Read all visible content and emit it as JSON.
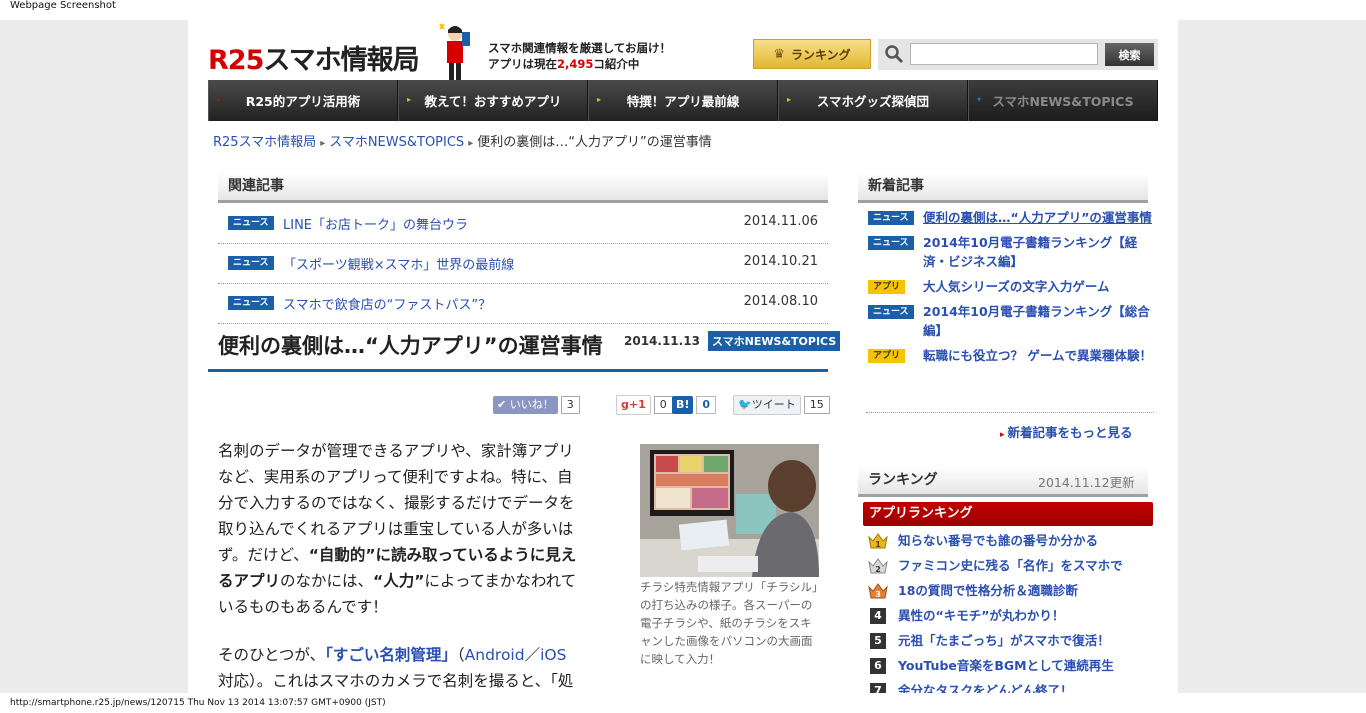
{
  "capture_label": "Webpage Screenshot",
  "status_bar": "http://smartphone.r25.jp/news/120715 Thu Nov 13 2014 13:07:57 GMT+0900 (JST)",
  "header": {
    "logo_r25": "R25",
    "logo_rest": "スマホ情報局",
    "tagline_line1": "スマホ関連情報を厳選してお届け！",
    "tagline_prefix": "アプリは現在",
    "tagline_count": "2,495",
    "tagline_suffix": "コ紹介中",
    "ranking_button": "ランキング",
    "search_placeholder": "",
    "search_button": "検索"
  },
  "nav": [
    {
      "label": "R25的アプリ活用術"
    },
    {
      "label": "教えて！おすすめアプリ"
    },
    {
      "label": "特撰！アプリ最前線"
    },
    {
      "label": "スマホグッズ探偵団"
    },
    {
      "label": "スマホNEWS&TOPICS"
    }
  ],
  "breadcrumb": {
    "home": "R25スマホ情報局",
    "section": "スマホNEWS&TOPICS",
    "current": "便利の裏側は…“人力アプリ”の運営事情"
  },
  "related": {
    "title": "関連記事",
    "items": [
      {
        "badge": "ニュース",
        "title": "LINE「お店トーク」の舞台ウラ",
        "date": "2014.11.06"
      },
      {
        "badge": "ニュース",
        "title": "「スポーツ観戦×スマホ」世界の最前線",
        "date": "2014.10.21"
      },
      {
        "badge": "ニュース",
        "title": "スマホで飲食店の“ファストパス”？",
        "date": "2014.08.10"
      }
    ]
  },
  "article": {
    "title": "便利の裏側は…“人力アプリ”の運営事情",
    "date": "2014.11.13",
    "category": "スマホNEWS&TOPICS",
    "social": {
      "like_label": "いいね！",
      "like_count": "3",
      "gplus_label": "g+1",
      "gplus_count": "0",
      "hatena_label": "B!",
      "hatena_count": "0",
      "tweet_label": "ツイート",
      "tweet_count": "15"
    },
    "p1_a": "名刺のデータが管理できるアプリや、家計簿アプリなど、実用系のアプリって便利ですよね。特に、自分で入力するのではなく、撮影するだけでデータを取り込んでくれるアプリは重宝している人が多いはず。だけど、",
    "p1_b": "“自動的”に読み取っているように見えるアプリ",
    "p1_c": "のなかには、",
    "p1_d": "“人力”",
    "p1_e": "によってまかなわれているものもあるんです！",
    "p2_a": "そのひとつが、",
    "p2_b": "「すごい名刺管理」",
    "p2_c": "（",
    "p2_d": "Android",
    "p2_e": "／",
    "p2_f": "iOS",
    "p2_g": "対応）。これはスマホのカメラで名刺を撮ると、「処理",
    "photo_caption": "チラシ特売情報アプリ「チラシル」の打ち込みの様子。各スーパーの電子チラシや、紙のチラシをスキャンした画像をパソコンの大画面に映して入力！"
  },
  "sidebar": {
    "new_title": "新着記事",
    "new_items": [
      {
        "badge": "ニュース",
        "type": "news",
        "title": "便利の裏側は…“人力アプリ”の運営事情"
      },
      {
        "badge": "ニュース",
        "type": "news",
        "title": "2014年10月電子書籍ランキング【経済・ビジネス編】"
      },
      {
        "badge": "アプリ",
        "type": "app",
        "title": "大人気シリーズの文字入力ゲーム"
      },
      {
        "badge": "ニュース",
        "type": "news",
        "title": "2014年10月電子書籍ランキング【総合編】"
      },
      {
        "badge": "アプリ",
        "type": "app",
        "title": "転職にも役立つ？ ゲームで異業種体験！"
      }
    ],
    "more_link": "新着記事をもっと見る",
    "ranking_title": "ランキング",
    "ranking_updated": "2014.11.12更新",
    "ranking_sub": "アプリランキング",
    "ranking": [
      {
        "rank": "1",
        "title": "知らない番号でも誰の番号か分かる"
      },
      {
        "rank": "2",
        "title": "ファミコン史に残る「名作」をスマホで"
      },
      {
        "rank": "3",
        "title": "18の質問で性格分析＆適職診断"
      },
      {
        "rank": "4",
        "title": "異性の“キモチ”が丸わかり！"
      },
      {
        "rank": "5",
        "title": "元祖「たまごっち」がスマホで復活！"
      },
      {
        "rank": "6",
        "title": "YouTube音楽をBGMとして連続再生"
      },
      {
        "rank": "7",
        "title": "余分なタスクをどんどん終了！"
      }
    ]
  },
  "colors": {
    "brand_red": "#d40000",
    "link_blue": "#2a4fb0",
    "news_badge": "#1a5fa8",
    "app_badge": "#f5c400"
  }
}
